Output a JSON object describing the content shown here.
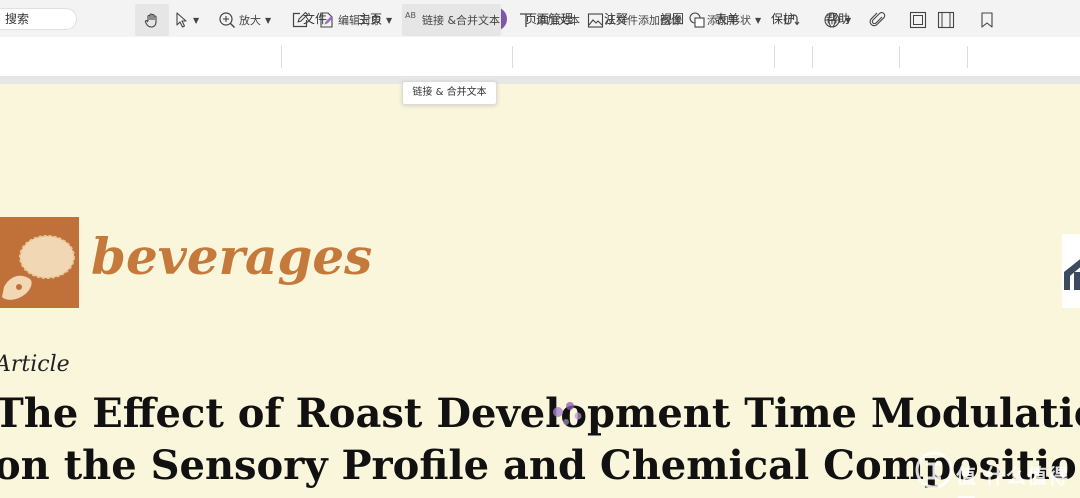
{
  "search": {
    "placeholder": "搜索"
  },
  "menu": {
    "items": [
      {
        "label": "文件"
      },
      {
        "label": "主页"
      },
      {
        "label": "转换"
      },
      {
        "label": "编辑",
        "active": true
      },
      {
        "label": "页面管理"
      },
      {
        "label": "注释"
      },
      {
        "label": "视图"
      },
      {
        "label": "表单"
      },
      {
        "label": "保护"
      },
      {
        "label": "帮助"
      }
    ]
  },
  "toolbar": {
    "zoom_label": "放大",
    "edit_object_label": "编辑对象",
    "link_merge_label": "链接 &合并文本",
    "add_text_label": "添加文本",
    "add_image_label": "从文件添加图像",
    "add_shape_label": "添加形状",
    "link_merge_badge": "AB"
  },
  "tooltip": {
    "text": "链接 & 合并文本"
  },
  "document": {
    "journal_name": "beverages",
    "article_type": "Article",
    "title_line1": "The Effect of Roast Development Time Modulatio",
    "title_line2": "on the Sensory Profile and Chemical Compositio"
  },
  "watermark": {
    "text": "值 什么值得买"
  },
  "colors": {
    "accent": "#7f56a9",
    "journal_brand": "#c57a3c",
    "logo_bg": "#c0713a",
    "page_bg": "#faf6dc"
  }
}
